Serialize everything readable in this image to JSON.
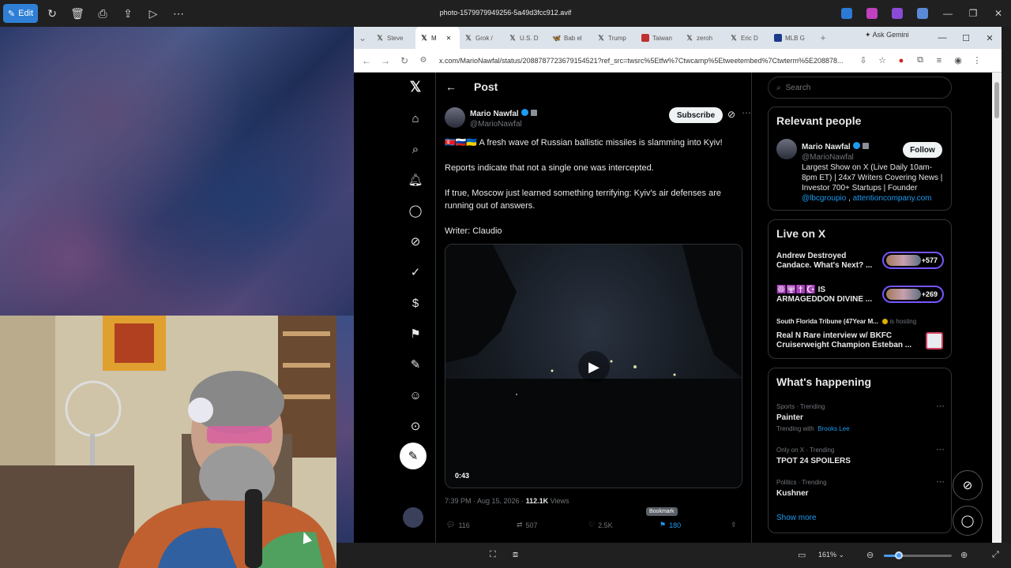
{
  "viewer": {
    "edit_label": "Edit",
    "file_title": "photo-1579979949256-5a49d3fcc912.avif",
    "zoom_level": "161%",
    "zoom_fraction": 0.22
  },
  "browser": {
    "tabs": [
      {
        "label": "Steve",
        "icon": "x-logo"
      },
      {
        "label": "M",
        "icon": "x-logo",
        "active": true
      },
      {
        "label": "Grok /",
        "icon": "x-logo"
      },
      {
        "label": "U.S. D",
        "icon": "x-logo"
      },
      {
        "label": "Bab el",
        "icon": "bluesky-logo"
      },
      {
        "label": "Trump",
        "icon": "x-logo"
      },
      {
        "label": "Taiwan",
        "icon": "site-icon"
      },
      {
        "label": "zeroh",
        "icon": "x-logo"
      },
      {
        "label": "Eric D",
        "icon": "x-logo"
      },
      {
        "label": "MLB G",
        "icon": "mlb-logo"
      }
    ],
    "ask_gemini": "Ask Gemini",
    "url": "x.com/MarioNawfal/status/2088787723679154521?ref_src=twsrc%5Etfw%7Ctwcamp%5Etweetembed%7Ctwterm%5E208878..."
  },
  "x": {
    "post_header": "Post",
    "author_name": "Mario Nawfal",
    "author_handle": "@MarioNawfal",
    "subscribe": "Subscribe",
    "tweet_lines": [
      "🇰🇵🇷🇺🇺🇦 A fresh wave of Russian ballistic missiles is slamming into Kyiv!",
      "Reports indicate that not a single one was intercepted.",
      "If true, Moscow just learned something terrifying: Kyiv's air defenses are running out of answers.",
      "Writer: Claudio"
    ],
    "video_time": "0:43",
    "timestamp": "7:39 PM · Aug 15, 2026 ·",
    "views_count": "112.1K",
    "views_label": "Views",
    "replies": "116",
    "reposts": "507",
    "likes": "2.5K",
    "bookmarks": "180",
    "bookmark_tooltip": "Bookmark",
    "search_placeholder": "Search",
    "relevant_title": "Relevant people",
    "relevant_name": "Mario Nawfal",
    "relevant_handle": "@MarioNawfal",
    "follow": "Follow",
    "bio": "Largest Show on X (Live Daily 10am-8pm ET) | 24x7 Writers Covering News | Investor 700+ Startups | Founder",
    "bio_link1": "@lbcgroupio",
    "bio_sep": " , ",
    "bio_link2": "attentioncompany.com",
    "live_title": "Live on X",
    "live": [
      {
        "title": "Andrew Destroyed Candace. What's Next? ...",
        "count": "+577"
      },
      {
        "title": "☸️🕎✝️☪️ IS ARMAGEDDON DIVINE ...",
        "count": "+269"
      }
    ],
    "live3_host": "South Florida Tribune (47Year M...",
    "live3_hosting": "is hosting",
    "live3_title": "Real N Rare interview w/ BKFC Cruiserweight Champion Esteban ...",
    "happening_title": "What's happening",
    "trends": [
      {
        "cat": "Sports · Trending",
        "name": "Painter",
        "extra_prefix": "Trending with",
        "extra_link": "Brooks Lee"
      },
      {
        "cat": "Only on X · Trending",
        "name": "TPOT 24 SPOILERS"
      },
      {
        "cat": "Politics · Trending",
        "name": "Kushner"
      }
    ],
    "show_more": "Show more"
  },
  "colors": {
    "accent": "#1d9bf0",
    "edit_button": "#2f7fd6",
    "live_pill_border": "#7856ff"
  }
}
